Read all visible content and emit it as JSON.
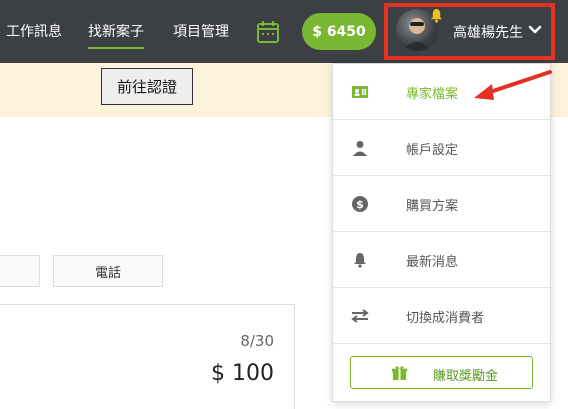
{
  "nav": {
    "items": [
      {
        "label": "工作訊息",
        "active": false
      },
      {
        "label": "找新案子",
        "active": true
      },
      {
        "label": "項目管理",
        "active": false
      }
    ],
    "calendar_icon": "calendar-icon",
    "balance": "$ 6450"
  },
  "user": {
    "name": "高雄楊先生",
    "avatar_icon": "avatar",
    "notification_icon": "bell-icon"
  },
  "banner": {
    "verify_button": "前往認證"
  },
  "form": {
    "phone_label": "電話"
  },
  "card": {
    "date": "8/30",
    "price": "$ 100"
  },
  "dropdown": {
    "items": [
      {
        "label": "專家檔案",
        "icon": "id-card-icon",
        "active": true
      },
      {
        "label": "帳戶設定",
        "icon": "user-icon",
        "active": false
      },
      {
        "label": "購買方案",
        "icon": "dollar-icon",
        "active": false
      },
      {
        "label": "最新消息",
        "icon": "bell-icon",
        "active": false
      },
      {
        "label": "切換成消費者",
        "icon": "swap-icon",
        "active": false
      }
    ],
    "reward_button": "賺取獎勵金",
    "reward_icon": "gift-icon"
  },
  "colors": {
    "accent": "#7ab833",
    "topbar": "#3c3f43",
    "highlight": "#e53122"
  }
}
